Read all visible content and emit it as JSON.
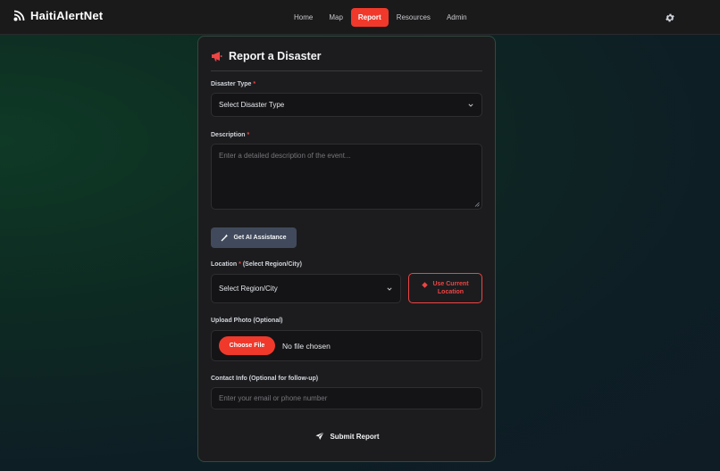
{
  "brand": {
    "name": "HaitiAlertNet"
  },
  "nav": {
    "items": [
      {
        "label": "Home",
        "active": false
      },
      {
        "label": "Map",
        "active": false
      },
      {
        "label": "Report",
        "active": true
      },
      {
        "label": "Resources",
        "active": false
      },
      {
        "label": "Admin",
        "active": false
      }
    ]
  },
  "form": {
    "title": "Report a Disaster",
    "disaster_type": {
      "label": "Disaster Type",
      "required_mark": "*",
      "selected": "Select Disaster Type"
    },
    "description": {
      "label": "Description",
      "required_mark": "*",
      "placeholder": "Enter a detailed description of the event..."
    },
    "ai_button": "Get AI Assistance",
    "location": {
      "label": "Location",
      "required_mark": "*",
      "label_suffix": "(Select Region/City)",
      "selected": "Select Region/City",
      "use_current_line1": "Use Current",
      "use_current_line2": "Location"
    },
    "upload": {
      "label": "Upload Photo (Optional)",
      "button": "Choose File",
      "status": "No file chosen"
    },
    "contact": {
      "label": "Contact Info (Optional for follow-up)",
      "placeholder": "Enter your email or phone number"
    },
    "submit": "Submit Report"
  },
  "colors": {
    "accent": "#f0392b",
    "background": "#0f2a22",
    "card": "#1c1c1e",
    "secondary_button": "#414a5c"
  },
  "icons": {
    "brand": "satellite-icon",
    "settings": "gear-icon",
    "title": "megaphone-icon",
    "ai": "magic-wand-icon",
    "location": "map-marker-icon",
    "submit": "paper-plane-icon"
  }
}
